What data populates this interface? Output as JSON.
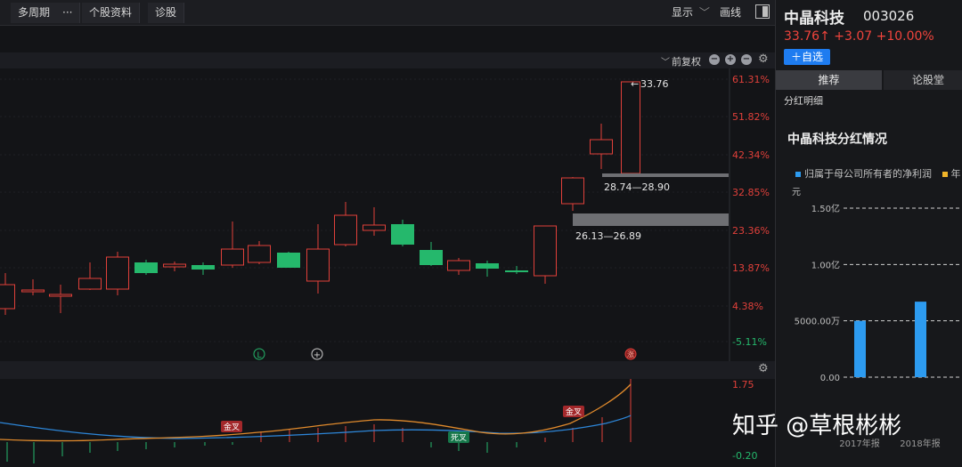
{
  "toolbar": {
    "multi_period": "多周期",
    "more": "···",
    "stock_info": "个股资料",
    "diagnosis": "诊股",
    "display": "显示",
    "line": "画线"
  },
  "price_bar": {
    "adjust_label": "前复权"
  },
  "main_chart": {
    "y_ticks": [
      "61.31%",
      "51.82%",
      "42.34%",
      "32.85%",
      "23.36%",
      "13.87%",
      "4.38%",
      "-5.11%"
    ],
    "last_price_label": "33.76",
    "zones": [
      {
        "label": "28.74—28.90"
      },
      {
        "label": "26.13—26.89"
      }
    ],
    "marker_l": "L",
    "marker_plus": "+",
    "marker_zhang": "涨",
    "up_color": "#e0403a",
    "down_color": "#25b86c"
  },
  "indicator": {
    "y_top": "1.75",
    "y_bottom": "-0.20",
    "labels": [
      {
        "text": "金叉",
        "type": "golden"
      },
      {
        "text": "死叉",
        "type": "death"
      },
      {
        "text": "金叉",
        "type": "golden"
      }
    ]
  },
  "right_panel": {
    "name": "中晶科技",
    "code": "003026",
    "price": "33.76↑ +3.07 +10.00%",
    "fav_button": "＋自选",
    "tabs": [
      "推荐",
      "论股堂"
    ],
    "section": "分红明细",
    "dividend_title": "中晶科技分红情况",
    "legend_1": "归属于母公司所有者的净利润",
    "legend_2": "年",
    "unit": "元",
    "y_ticks": [
      "1.50亿",
      "1.00亿",
      "5000.00万",
      "0.00"
    ],
    "x_labels": [
      "2017年报",
      "2018年报"
    ],
    "bar_color": "#2d9bf0",
    "legend_2_color": "#f0b429"
  },
  "chart_data": {
    "type": "bar",
    "categories": [
      "2017年报",
      "2018年报"
    ],
    "series": [
      {
        "name": "归属于母公司所有者的净利润",
        "values": [
          50000000,
          67000000
        ]
      }
    ],
    "ylabel": "元",
    "ylim": [
      0,
      150000000
    ]
  },
  "watermark": "知乎 @草根彬彬"
}
